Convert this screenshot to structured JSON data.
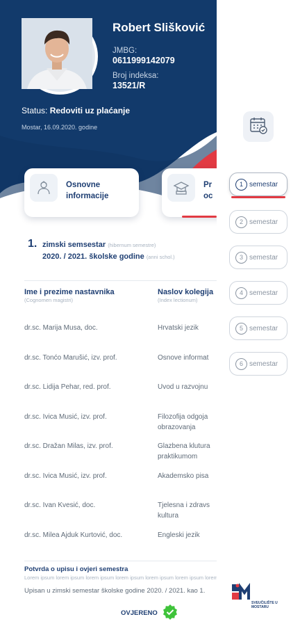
{
  "profile": {
    "name": "Robert Slišković",
    "jmbg_label": "JMBG:",
    "jmbg": "0611999142079",
    "index_label": "Broj indeksa:",
    "index": "13521/R",
    "status_label": "Status:",
    "status": "Redoviti uz plaćanje",
    "date": "Mostar, 16.09.2020. godine"
  },
  "cards": {
    "basic_label": "Osnovne informacije",
    "basic_line1": "Osnovne",
    "basic_line2": "informacije",
    "grades_line1": "Pr",
    "grades_line2": "oc"
  },
  "semester": {
    "number": "1.",
    "name": "zimski semsestar",
    "name_sub": "(hibernum semestre)",
    "year": "2020. / 2021. školske godine",
    "year_sub": "(anni schol.)"
  },
  "table": {
    "col1": "Ime i prezime nastavnika",
    "col1_sub": "(Cognomen magistri)",
    "col2": "Naslov kolegija",
    "col2_sub": "(Index lectionum)",
    "rows": [
      {
        "teacher": "dr.sc. Marija Musa, doc.",
        "course": "Hrvatski jezik",
        "course2": ""
      },
      {
        "teacher": "dr.sc. Tonćo Marušić, izv. prof.",
        "course": "Osnove informat",
        "course2": ""
      },
      {
        "teacher": "dr.sc. Lidija Pehar, red. prof.",
        "course": "Uvod u razvojnu",
        "course2": ""
      },
      {
        "teacher": "dr.sc. Ivica Musić, izv. prof.",
        "course": "Filozofija odgoja",
        "course2": "obrazovanja"
      },
      {
        "teacher": "dr.sc. Dražan Milas, izv. prof.",
        "course": "Glazbena klutura",
        "course2": "praktikumom"
      },
      {
        "teacher": "dr.sc. Ivica Musić, izv. prof.",
        "course": "Akademsko pisa",
        "course2": ""
      },
      {
        "teacher": "dr.sc. Ivan Kvesić, doc.",
        "course": "Tjelesna i zdravs",
        "course2": "kultura"
      },
      {
        "teacher": "dr.sc. Milea Ajduk Kurtović, doc.",
        "course": "Engleski jezik",
        "course2": ""
      }
    ]
  },
  "footer": {
    "title": "Potvrda o upisu i ovjeri semestra",
    "lorem": "Lorem ipsum lorem ipsum lorem ipsum lorem ipsum lorem ipsum lorem ipsum lorem ipsum",
    "body": "Upisan u zimski semestar školske godine 2020. / 2021. kao 1.",
    "verified": "OVJERENO"
  },
  "sidebar": {
    "semesters": [
      {
        "num": "1",
        "label": "semestar"
      },
      {
        "num": "2",
        "label": "semestar"
      },
      {
        "num": "3",
        "label": "semestar"
      },
      {
        "num": "4",
        "label": "semestar"
      },
      {
        "num": "5",
        "label": "semestar"
      },
      {
        "num": "6",
        "label": "semestar"
      }
    ],
    "calendar_icon": "calendar-check-icon",
    "logo_text": "SVEUČILIŠTE U MOSTARU"
  },
  "colors": {
    "primary": "#1f3f73",
    "accent": "#e23a43",
    "success": "#3fc33a"
  }
}
